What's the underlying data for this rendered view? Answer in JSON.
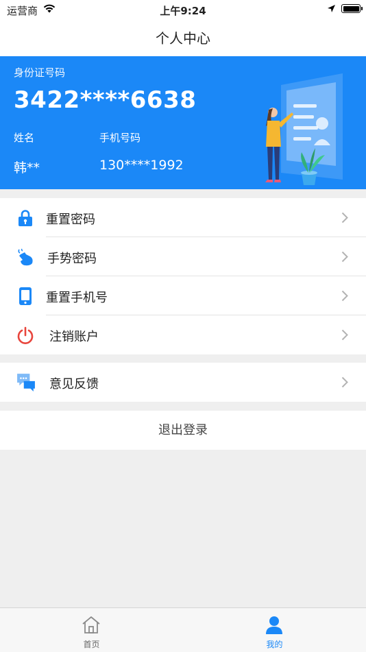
{
  "status_bar": {
    "carrier": "运营商",
    "time": "上午9:24"
  },
  "nav": {
    "title": "个人中心"
  },
  "profile_card": {
    "id_label": "身份证号码",
    "id_number": "3422****6638",
    "name_label": "姓名",
    "phone_label": "手机号码",
    "name_value": "韩**",
    "phone_value": "130****1992"
  },
  "menu": {
    "items": [
      {
        "label": "重置密码",
        "icon": "lock-icon"
      },
      {
        "label": "手势密码",
        "icon": "gesture-hand-icon"
      },
      {
        "label": "重置手机号",
        "icon": "phone-icon"
      },
      {
        "label": "注销账户",
        "icon": "power-icon"
      }
    ]
  },
  "feedback": {
    "label": "意见反馈",
    "icon": "chat-bubbles-icon"
  },
  "logout": {
    "label": "退出登录"
  },
  "tabbar": {
    "tabs": [
      {
        "label": "首页",
        "icon": "home-icon",
        "active": false
      },
      {
        "label": "我的",
        "icon": "user-icon",
        "active": true
      }
    ]
  },
  "colors": {
    "primary": "#1b88f7",
    "danger": "#e8453c",
    "background": "#efefef"
  }
}
